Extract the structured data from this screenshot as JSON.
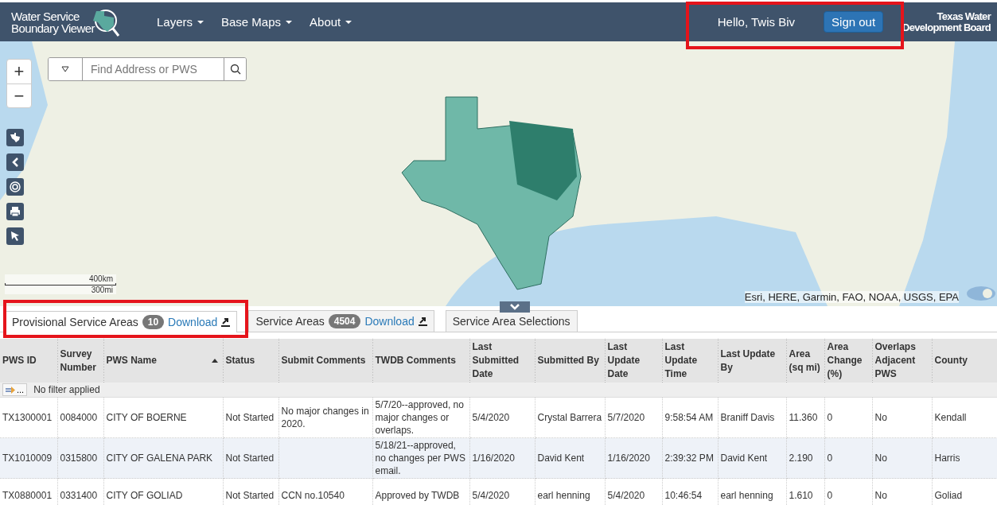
{
  "header": {
    "logo_lines": [
      "Water Service",
      "Boundary Viewer"
    ],
    "menus": [
      {
        "label": "Layers"
      },
      {
        "label": "Base Maps"
      },
      {
        "label": "About"
      }
    ],
    "greeting": "Hello, Twis Biv",
    "sign_out": "Sign out",
    "agency_lines": [
      "Texas Water",
      "Development Board"
    ]
  },
  "map": {
    "search": {
      "placeholder": "Find Address or PWS"
    },
    "zoom_in": "+",
    "zoom_out": "−",
    "scale": [
      "400km",
      "300mi"
    ],
    "attribution": "Esri, HERE, Garmin, FAO, NOAA, USGS, EPA"
  },
  "tabs": [
    {
      "label": "Provisional Service Areas",
      "count": "10",
      "download": "Download",
      "selected": true
    },
    {
      "label": "Service Areas",
      "count": "4504",
      "download": "Download",
      "selected": false
    },
    {
      "label": "Service Area Selections",
      "selected": false
    }
  ],
  "table": {
    "columns": [
      {
        "label": "PWS ID"
      },
      {
        "label": "Survey Number"
      },
      {
        "label": "PWS Name",
        "sorted": true
      },
      {
        "label": "Status"
      },
      {
        "label": "Submit Comments"
      },
      {
        "label": "TWDB Comments"
      },
      {
        "label": "Last Submitted Date"
      },
      {
        "label": "Submitted By"
      },
      {
        "label": "Last Update Date"
      },
      {
        "label": "Last Update Time"
      },
      {
        "label": "Last Update By"
      },
      {
        "label": "Area (sq mi)"
      },
      {
        "label": "Area Change (%)"
      },
      {
        "label": "Overlaps Adjacent PWS"
      },
      {
        "label": "County"
      }
    ],
    "filter": {
      "button": "...",
      "text": "No filter applied"
    },
    "rows": [
      [
        "TX1300001",
        "0084000",
        "CITY OF BOERNE",
        "Not Started",
        "No major changes in 2020.",
        "5/7/20--approved, no major changes or overlaps.",
        "5/4/2020",
        "Crystal Barrera",
        "5/7/2020",
        "9:58:54 AM",
        "Braniff Davis",
        "11.360",
        "0",
        "No",
        "Kendall"
      ],
      [
        "TX1010009",
        "0315800",
        "CITY OF GALENA PARK",
        "Not Started",
        "",
        "5/18/21--approved, no changes per PWS email.",
        "1/16/2020",
        "David Kent",
        "1/16/2020",
        "2:39:32 PM",
        "David Kent",
        "2.190",
        "0",
        "No",
        "Harris"
      ],
      [
        "TX0880001",
        "0331400",
        "CITY OF GOLIAD",
        "Not Started",
        "CCN no.10540",
        "Approved by TWDB",
        "5/4/2020",
        "earl henning",
        "5/4/2020",
        "10:46:54",
        "earl henning",
        "1.610",
        "0",
        "No",
        "Goliad"
      ]
    ]
  }
}
